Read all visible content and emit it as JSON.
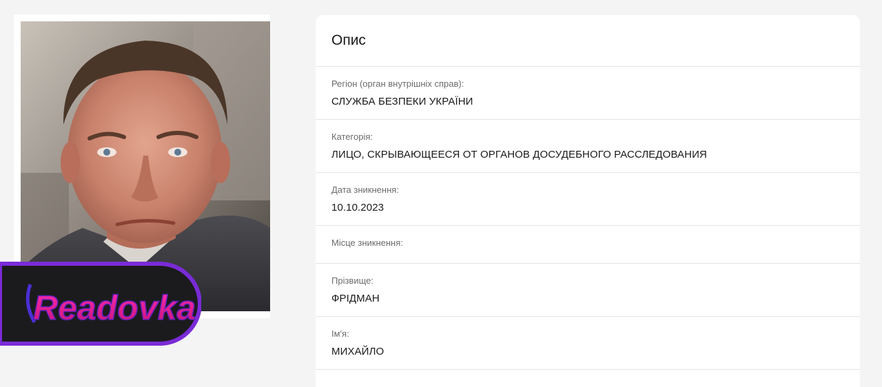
{
  "watermark": {
    "text": "Readovka"
  },
  "card": {
    "title": "Опис",
    "fields": [
      {
        "label": "Регіон (орган внутрішніх справ):",
        "value": "СЛУЖБА БЕЗПЕКИ УКРАЇНИ"
      },
      {
        "label": "Категорія:",
        "value": "ЛИЦО, СКРЫВАЮЩЕЕСЯ ОТ ОРГАНОВ ДОСУДЕБНОГО РАССЛЕДОВАНИЯ"
      },
      {
        "label": "Дата зникнення:",
        "value": "10.10.2023"
      },
      {
        "label": "Місце зникнення:",
        "value": ""
      },
      {
        "label": "Прізвище:",
        "value": "ФРІДМАН"
      },
      {
        "label": "Ім'я:",
        "value": "МИХАЙЛО"
      }
    ]
  },
  "colors": {
    "page_background": "#f4f4f4",
    "card_background": "#ffffff",
    "divider": "#e3e3e3",
    "watermark_border": "#7a2bd6",
    "watermark_text": "#e0249a"
  }
}
